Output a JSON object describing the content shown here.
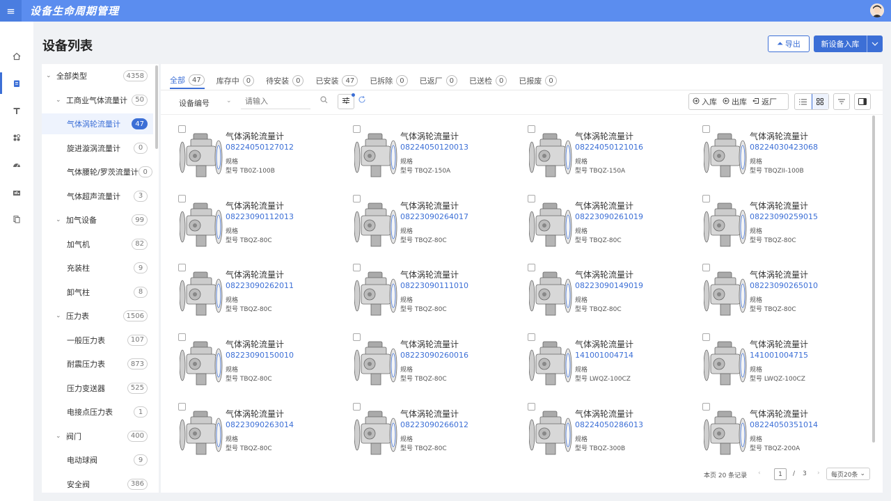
{
  "app": {
    "title": "设备生命周期管理"
  },
  "page": {
    "title": "设备列表"
  },
  "header_actions": {
    "export_label": "导出",
    "new_label": "新设备入库"
  },
  "sidebar": {
    "items": [
      {
        "name": "home-icon"
      },
      {
        "name": "device-icon",
        "active": true
      },
      {
        "name": "tool-icon"
      },
      {
        "name": "module-icon"
      },
      {
        "name": "dashboard-icon"
      },
      {
        "name": "stats-icon"
      },
      {
        "name": "docs-icon"
      }
    ]
  },
  "tree": {
    "items": [
      {
        "label": "全部类型",
        "count": "4358",
        "level": 0,
        "arrow": "⌄"
      },
      {
        "label": "工商业气体流量计",
        "count": "50",
        "level": 1,
        "arrow": "⌄"
      },
      {
        "label": "气体涡轮流量计",
        "count": "47",
        "level": 2,
        "active": true
      },
      {
        "label": "旋进漩涡流量计",
        "count": "0",
        "level": 2
      },
      {
        "label": "气体腰轮/罗茨流量计",
        "count": "0",
        "level": 2
      },
      {
        "label": "气体超声流量计",
        "count": "3",
        "level": 2
      },
      {
        "label": "加气设备",
        "count": "99",
        "level": 1,
        "arrow": "⌄"
      },
      {
        "label": "加气机",
        "count": "82",
        "level": 2
      },
      {
        "label": "充装柱",
        "count": "9",
        "level": 2
      },
      {
        "label": "卸气柱",
        "count": "8",
        "level": 2
      },
      {
        "label": "压力表",
        "count": "1506",
        "level": 1,
        "arrow": "⌄"
      },
      {
        "label": "一般压力表",
        "count": "107",
        "level": 2
      },
      {
        "label": "耐震压力表",
        "count": "873",
        "level": 2
      },
      {
        "label": "压力变送器",
        "count": "525",
        "level": 2
      },
      {
        "label": "电接点压力表",
        "count": "1",
        "level": 2
      },
      {
        "label": "阀门",
        "count": "400",
        "level": 1,
        "arrow": "⌄"
      },
      {
        "label": "电动球阀",
        "count": "9",
        "level": 2
      },
      {
        "label": "安全阀",
        "count": "386",
        "level": 2
      }
    ]
  },
  "tabs": [
    {
      "label": "全部",
      "count": "47",
      "active": true
    },
    {
      "label": "库存中",
      "count": "0"
    },
    {
      "label": "待安装",
      "count": "0"
    },
    {
      "label": "已安装",
      "count": "47"
    },
    {
      "label": "已拆除",
      "count": "0"
    },
    {
      "label": "已返厂",
      "count": "0"
    },
    {
      "label": "已送检",
      "count": "0"
    },
    {
      "label": "已报废",
      "count": "0"
    }
  ],
  "search": {
    "field_label": "设备编号",
    "placeholder": "请输入"
  },
  "actions": {
    "in_label": "入库",
    "out_label": "出库",
    "return_label": "返厂"
  },
  "cards": [
    {
      "name": "气体涡轮流量计",
      "code": "08224050127012",
      "spec": "规格",
      "model": "型号 TB0Z-100B"
    },
    {
      "name": "气体涡轮流量计",
      "code": "08224050120013",
      "spec": "规格",
      "model": "型号 TBQZ-150A"
    },
    {
      "name": "气体涡轮流量计",
      "code": "08224050121016",
      "spec": "规格",
      "model": "型号 TBQZ-150A"
    },
    {
      "name": "气体涡轮流量计",
      "code": "08224030423068",
      "spec": "规格",
      "model": "型号 TBQZII-100B"
    },
    {
      "name": "气体涡轮流量计",
      "code": "08223090112013",
      "spec": "规格",
      "model": "型号 TBQZ-80C"
    },
    {
      "name": "气体涡轮流量计",
      "code": "08223090264017",
      "spec": "规格",
      "model": "型号 TBQZ-80C"
    },
    {
      "name": "气体涡轮流量计",
      "code": "08223090261019",
      "spec": "规格",
      "model": "型号 TBQZ-80C"
    },
    {
      "name": "气体涡轮流量计",
      "code": "08223090259015",
      "spec": "规格",
      "model": "型号 TBQZ-80C"
    },
    {
      "name": "气体涡轮流量计",
      "code": "08223090262011",
      "spec": "规格",
      "model": "型号 TBQZ-80C"
    },
    {
      "name": "气体涡轮流量计",
      "code": "08223090111010",
      "spec": "规格",
      "model": "型号 TBQZ-80C"
    },
    {
      "name": "气体涡轮流量计",
      "code": "08223090149019",
      "spec": "规格",
      "model": "型号 TBQZ-80C"
    },
    {
      "name": "气体涡轮流量计",
      "code": "08223090265010",
      "spec": "规格",
      "model": "型号 TBQZ-80C"
    },
    {
      "name": "气体涡轮流量计",
      "code": "08223090150010",
      "spec": "规格",
      "model": "型号 TBQZ-80C"
    },
    {
      "name": "气体涡轮流量计",
      "code": "08223090260016",
      "spec": "规格",
      "model": "型号 TBQZ-80C"
    },
    {
      "name": "气体涡轮流量计",
      "code": "141001004714",
      "spec": "规格",
      "model": "型号 LWQZ-100CZ"
    },
    {
      "name": "气体涡轮流量计",
      "code": "141001004715",
      "spec": "规格",
      "model": "型号 LWQZ-100CZ"
    },
    {
      "name": "气体涡轮流量计",
      "code": "08223090263014",
      "spec": "规格",
      "model": "型号 TBQZ-80C"
    },
    {
      "name": "气体涡轮流量计",
      "code": "08223090266012",
      "spec": "规格",
      "model": "型号 TBQZ-80C"
    },
    {
      "name": "气体涡轮流量计",
      "code": "08224050286013",
      "spec": "规格",
      "model": "型号 TBQZ-300B"
    },
    {
      "name": "气体涡轮流量计",
      "code": "08224050351014",
      "spec": "规格",
      "model": "型号 TBQZ-200A"
    }
  ],
  "pager": {
    "summary": "本页 20 条记录",
    "current": "1",
    "separator": "/",
    "total": "3",
    "page_size": "每页20条"
  },
  "colors": {
    "brand": "#5b8def",
    "accent": "#3c6fd6"
  }
}
